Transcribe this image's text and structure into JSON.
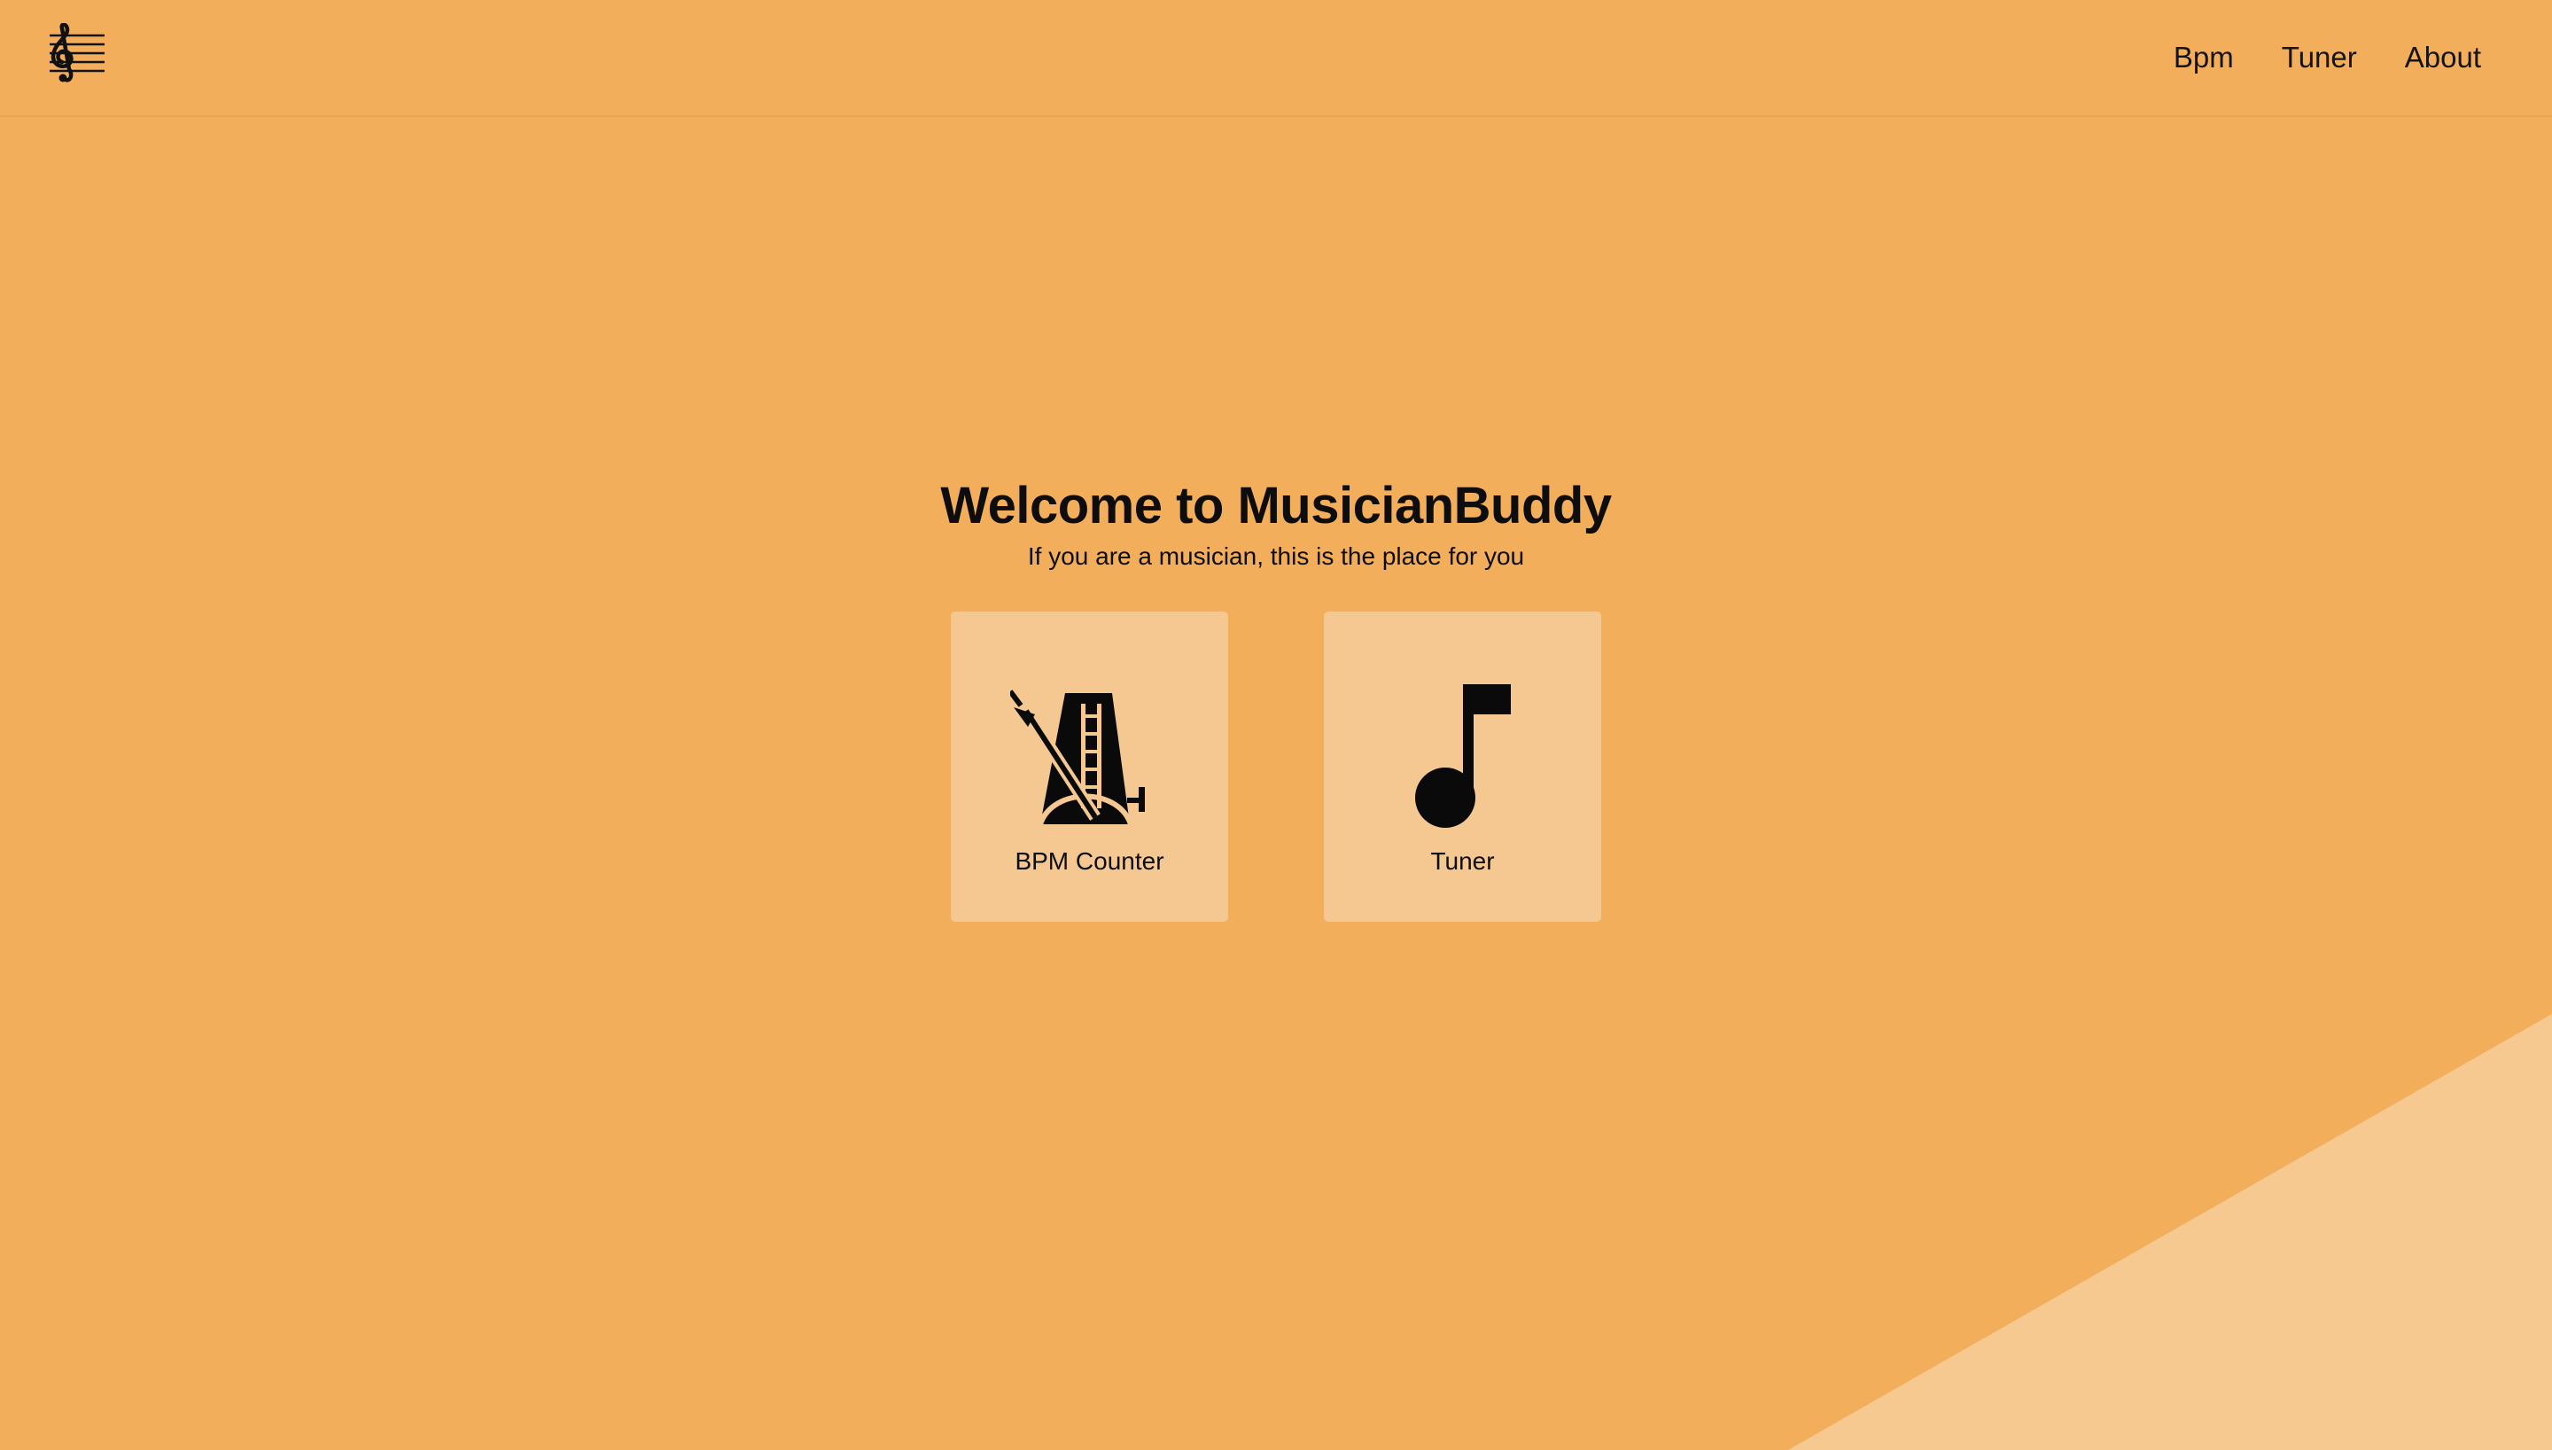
{
  "app": {
    "name": "MusicianBuddy",
    "logo_icon": "treble-clef-staff-icon"
  },
  "nav": {
    "items": [
      {
        "label": "Bpm"
      },
      {
        "label": "Tuner"
      },
      {
        "label": "About"
      }
    ]
  },
  "hero": {
    "title": "Welcome to MusicianBuddy",
    "subtitle": "If you are a musician, this is the place for you"
  },
  "cards": [
    {
      "label": "BPM Counter",
      "icon": "metronome-icon"
    },
    {
      "label": "Tuner",
      "icon": "music-note-icon"
    }
  ],
  "colors": {
    "background": "#f3ae5b",
    "card": "#f5c892",
    "corner_accent": "#f5c892",
    "text": "#0d0d0d"
  }
}
